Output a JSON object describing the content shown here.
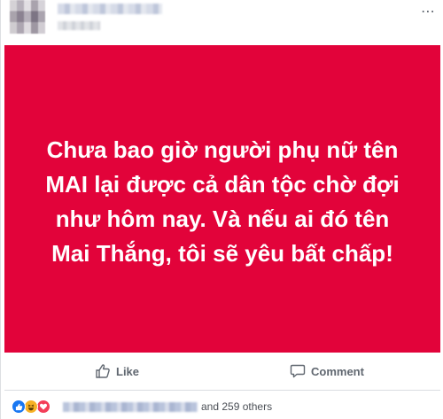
{
  "post": {
    "card_text": "Chưa bao giờ người phụ nữ tên MAI lại được cả dân tộc chờ đợi như hôm nay. Và nếu ai đó tên Mai Thắng, tôi sẽ yêu bất chấp!",
    "card_color": "#e2033a"
  },
  "actions": {
    "like_label": "Like",
    "comment_label": "Comment"
  },
  "reactions": {
    "others_text": "and 259 others",
    "icons": [
      "like-icon",
      "haha-icon",
      "love-icon"
    ]
  }
}
